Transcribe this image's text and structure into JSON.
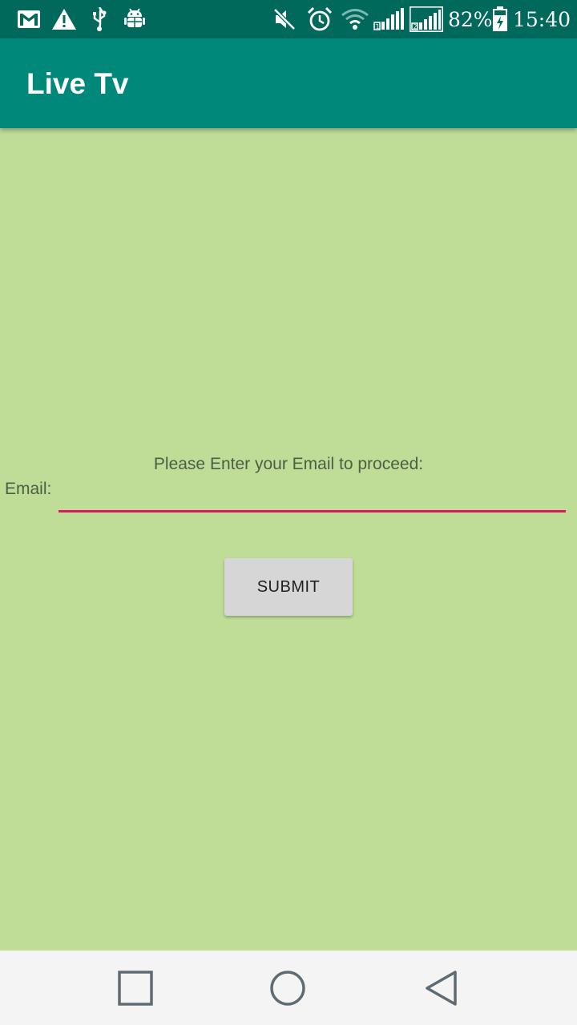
{
  "status_bar": {
    "battery_percent": "82%",
    "time": "15:40",
    "icons": [
      "gmail-icon",
      "warning-icon",
      "usb-icon",
      "android-debug-icon",
      "mute-icon",
      "alarm-icon",
      "wifi-icon",
      "signal-sim1-icon",
      "signal-sim2-icon",
      "battery-charging-icon"
    ],
    "sim1_label": "1",
    "sim2_label": "2"
  },
  "app_bar": {
    "title": "Live Tv"
  },
  "form": {
    "prompt": "Please Enter your Email to proceed:",
    "email_label": "Email:",
    "email_value": "",
    "submit_label": "SUBMIT"
  },
  "nav_bar": {
    "icons": [
      "recents-icon",
      "home-icon",
      "back-icon"
    ]
  },
  "colors": {
    "status_bar": "#00695c",
    "app_bar": "#00897b",
    "background": "#bfdd97",
    "input_underline": "#d81b60",
    "button": "#d6d6d6",
    "nav_bar": "#f4f4f4"
  }
}
